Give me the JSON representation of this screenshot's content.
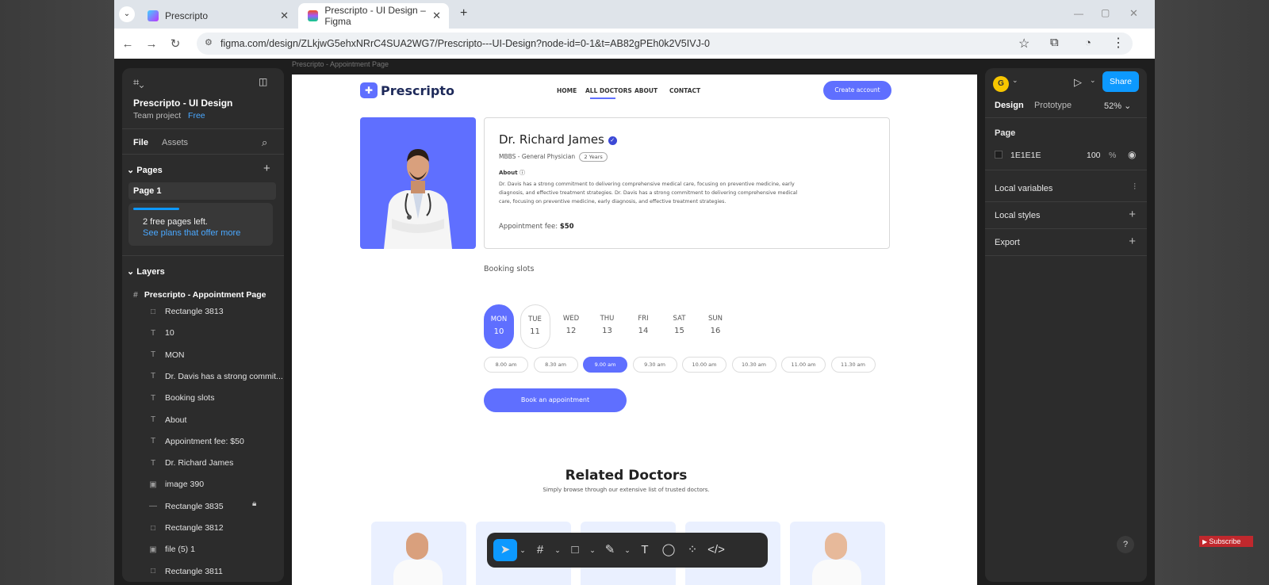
{
  "browser": {
    "tabs": [
      {
        "title": "Prescripto"
      },
      {
        "title": "Prescripto - UI Design – Figma"
      }
    ],
    "new_tab": "+",
    "url": "figma.com/design/ZLkjwG5ehxNRrC4SUA2WG7/Prescripto---UI-Design?node-id=0-1&t=AB82gPEh0k2V5IVJ-0"
  },
  "figma": {
    "frame_label": "Prescripto - Appointment Page",
    "left": {
      "project_title": "Prescripto - UI Design",
      "team": "Team project",
      "plan": "Free",
      "tab_file": "File",
      "tab_assets": "Assets",
      "pages_heading": "Pages",
      "page_1": "Page 1",
      "free_pages": "2 free pages left.",
      "see_plans": "See plans that offer more",
      "layers_heading": "Layers",
      "frame": "Prescripto - Appointment Page",
      "layers": [
        {
          "icon": "□",
          "name": "Rectangle 3813"
        },
        {
          "icon": "T",
          "name": "10"
        },
        {
          "icon": "T",
          "name": "MON"
        },
        {
          "icon": "T",
          "name": "Dr. Davis has a strong commit..."
        },
        {
          "icon": "T",
          "name": "Booking slots"
        },
        {
          "icon": "T",
          "name": "About"
        },
        {
          "icon": "T",
          "name": "Appointment fee: $50"
        },
        {
          "icon": "T",
          "name": "Dr. Richard James"
        },
        {
          "icon": "▣",
          "name": "image 390"
        },
        {
          "icon": "—",
          "name": "Rectangle 3835"
        },
        {
          "icon": "□",
          "name": "Rectangle 3812"
        },
        {
          "icon": "▣",
          "name": "file (5) 1"
        },
        {
          "icon": "□",
          "name": "Rectangle 3811"
        }
      ]
    },
    "right": {
      "avatar": "G",
      "share": "Share",
      "tab_design": "Design",
      "tab_prototype": "Prototype",
      "zoom": "52%",
      "page_heading": "Page",
      "bg_hex": "1E1E1E",
      "bg_opacity": "100",
      "percent": "%",
      "local_variables": "Local variables",
      "local_styles": "Local styles",
      "export": "Export"
    },
    "help": "?"
  },
  "site": {
    "logo": "Prescripto",
    "nav": [
      "HOME",
      "ALL DOCTORS",
      "ABOUT",
      "CONTACT"
    ],
    "create_account": "Create account",
    "doctor_name": "Dr. Richard James",
    "degree": "MBBS - General Physician",
    "experience": "2 Years",
    "about_label": "About",
    "about_text": "Dr. Davis has a strong commitment to delivering comprehensive medical care, focusing on preventive medicine, early diagnosis, and effective treatment strategies. Dr. Davis has a strong commitment to delivering comprehensive medical care, focusing on preventive medicine, early diagnosis, and effective treatment strategies.",
    "fee_label": "Appointment fee:",
    "fee_value": "$50",
    "booking_slots": "Booking slots",
    "days": [
      {
        "day": "MON",
        "date": "10"
      },
      {
        "day": "TUE",
        "date": "11"
      },
      {
        "day": "WED",
        "date": "12"
      },
      {
        "day": "THU",
        "date": "13"
      },
      {
        "day": "FRI",
        "date": "14"
      },
      {
        "day": "SAT",
        "date": "15"
      },
      {
        "day": "SUN",
        "date": "16"
      }
    ],
    "times": [
      "8.00 am",
      "8.30 am",
      "9.00 am",
      "9.30 am",
      "10.00 am",
      "10.30 am",
      "11.00 am",
      "11.30 am"
    ],
    "book_button": "Book an appointment",
    "related_title": "Related Doctors",
    "related_sub": "Simply browse through our extensive list of trusted doctors."
  },
  "colors": {
    "accent": "#5F6FFF",
    "figma_blue": "#0D99FF"
  },
  "overlay": {
    "subscribe": "Subscribe"
  }
}
